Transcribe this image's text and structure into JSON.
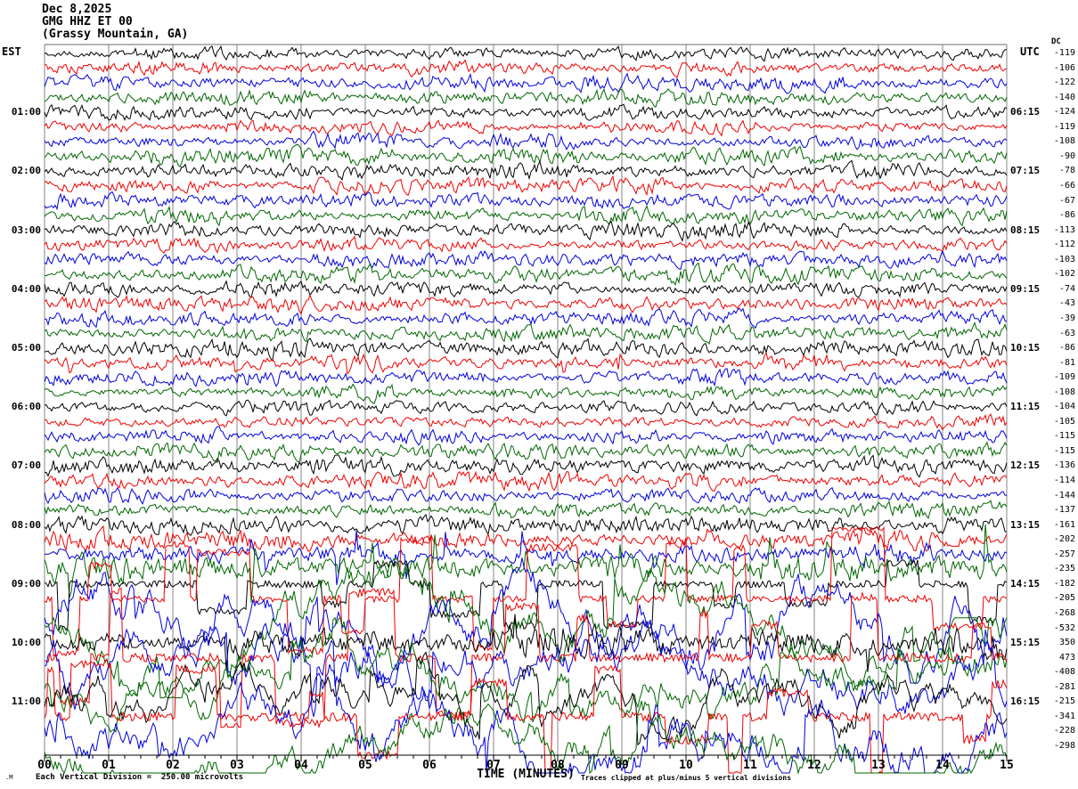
{
  "title": {
    "date": "Dec 8,2025",
    "station": "GMG HHZ ET 00",
    "location": "(Grassy Mountain, GA)"
  },
  "axes": {
    "left_header": "EST",
    "right_header": "UTC",
    "dc_header": "DC",
    "x_label": "TIME (MINUTES)",
    "x_ticks": [
      "00",
      "01",
      "02",
      "03",
      "04",
      "05",
      "06",
      "07",
      "08",
      "09",
      "10",
      "11",
      "12",
      "13",
      "14",
      "15"
    ],
    "minor_ticks_per_minute": 3,
    "footer_left": "Each Vertical Division =  250.00 microvolts",
    "footer_right": "Traces clipped at plus/minus 5 vertical divisions",
    "corner_mark": ".M"
  },
  "colors": {
    "black": "#000000",
    "red": "#ee0000",
    "blue": "#0000dd",
    "green": "#006600",
    "grid": "#858585",
    "border": "#6a6a6a",
    "axis": "#000000"
  },
  "chart_data": {
    "type": "line",
    "subtype": "seismogram-helicorder",
    "minutes_per_row": 15,
    "x_range_minutes": [
      0,
      15
    ],
    "vertical_division_microvolts": 250.0,
    "clip_divisions": 5,
    "rows": [
      {
        "est": "",
        "utc": "",
        "dc": "-119",
        "color": "black",
        "mode": "micro",
        "amp": 4
      },
      {
        "est": "",
        "utc": "",
        "dc": "-106",
        "color": "red",
        "mode": "micro",
        "amp": 4
      },
      {
        "est": "",
        "utc": "",
        "dc": "-122",
        "color": "blue",
        "mode": "micro",
        "amp": 4.5
      },
      {
        "est": "",
        "utc": "",
        "dc": "-140",
        "color": "green",
        "mode": "micro",
        "amp": 4.5
      },
      {
        "est": "01:00",
        "utc": "06:15",
        "dc": "-124",
        "color": "black",
        "mode": "micro",
        "amp": 4
      },
      {
        "est": "",
        "utc": "",
        "dc": "-119",
        "color": "red",
        "mode": "micro",
        "amp": 4
      },
      {
        "est": "",
        "utc": "",
        "dc": "-108",
        "color": "blue",
        "mode": "micro",
        "amp": 4.5
      },
      {
        "est": "",
        "utc": "",
        "dc": "-90",
        "color": "green",
        "mode": "micro",
        "amp": 5
      },
      {
        "est": "02:00",
        "utc": "07:15",
        "dc": "-78",
        "color": "black",
        "mode": "micro",
        "amp": 5
      },
      {
        "est": "",
        "utc": "",
        "dc": "-66",
        "color": "red",
        "mode": "micro",
        "amp": 4.5
      },
      {
        "est": "",
        "utc": "",
        "dc": "-67",
        "color": "blue",
        "mode": "micro",
        "amp": 4.5
      },
      {
        "est": "",
        "utc": "",
        "dc": "-86",
        "color": "green",
        "mode": "micro",
        "amp": 4.5
      },
      {
        "est": "03:00",
        "utc": "08:15",
        "dc": "-113",
        "color": "black",
        "mode": "micro",
        "amp": 5
      },
      {
        "est": "",
        "utc": "",
        "dc": "-112",
        "color": "red",
        "mode": "micro",
        "amp": 4.5
      },
      {
        "est": "",
        "utc": "",
        "dc": "-103",
        "color": "blue",
        "mode": "micro",
        "amp": 4.5
      },
      {
        "est": "",
        "utc": "",
        "dc": "-102",
        "color": "green",
        "mode": "micro",
        "amp": 5
      },
      {
        "est": "04:00",
        "utc": "09:15",
        "dc": "-74",
        "color": "black",
        "mode": "micro",
        "amp": 4.5
      },
      {
        "est": "",
        "utc": "",
        "dc": "-43",
        "color": "red",
        "mode": "micro",
        "amp": 4.5
      },
      {
        "est": "",
        "utc": "",
        "dc": "-39",
        "color": "blue",
        "mode": "micro",
        "amp": 4.5
      },
      {
        "est": "",
        "utc": "",
        "dc": "-63",
        "color": "green",
        "mode": "micro",
        "amp": 5
      },
      {
        "est": "05:00",
        "utc": "10:15",
        "dc": "-86",
        "color": "black",
        "mode": "micro",
        "amp": 5
      },
      {
        "est": "",
        "utc": "",
        "dc": "-81",
        "color": "red",
        "mode": "micro",
        "amp": 5.5,
        "spike": 10
      },
      {
        "est": "",
        "utc": "",
        "dc": "-109",
        "color": "blue",
        "mode": "micro",
        "amp": 4.5
      },
      {
        "est": "",
        "utc": "",
        "dc": "-108",
        "color": "green",
        "mode": "micro",
        "amp": 4.5
      },
      {
        "est": "06:00",
        "utc": "11:15",
        "dc": "-104",
        "color": "black",
        "mode": "micro",
        "amp": 4.5
      },
      {
        "est": "",
        "utc": "",
        "dc": "-105",
        "color": "red",
        "mode": "micro",
        "amp": 4.5
      },
      {
        "est": "",
        "utc": "",
        "dc": "-115",
        "color": "blue",
        "mode": "micro",
        "amp": 4.5
      },
      {
        "est": "",
        "utc": "",
        "dc": "-115",
        "color": "green",
        "mode": "micro",
        "amp": 4.5
      },
      {
        "est": "07:00",
        "utc": "12:15",
        "dc": "-136",
        "color": "black",
        "mode": "micro",
        "amp": 5
      },
      {
        "est": "",
        "utc": "",
        "dc": "-114",
        "color": "red",
        "mode": "micro",
        "amp": 5
      },
      {
        "est": "",
        "utc": "",
        "dc": "-144",
        "color": "blue",
        "mode": "micro",
        "amp": 4.5
      },
      {
        "est": "",
        "utc": "",
        "dc": "-137",
        "color": "green",
        "mode": "micro",
        "amp": 4.5
      },
      {
        "est": "08:00",
        "utc": "13:15",
        "dc": "-161",
        "color": "black",
        "mode": "micro",
        "amp": 5
      },
      {
        "est": "",
        "utc": "",
        "dc": "-202",
        "color": "red",
        "mode": "micro",
        "amp": 5.5,
        "spike": 12
      },
      {
        "est": "",
        "utc": "",
        "dc": "-257",
        "color": "blue",
        "mode": "micro",
        "amp": 6.5,
        "spike": 28,
        "clip": 60
      },
      {
        "est": "",
        "utc": "",
        "dc": "-235",
        "color": "green",
        "mode": "micro",
        "amp": 8,
        "spike": 45,
        "clip": 70
      },
      {
        "est": "09:00",
        "utc": "14:15",
        "dc": "-182",
        "color": "black",
        "mode": "telegraph",
        "amp": 4,
        "clip": 55,
        "p": 0.05,
        "bias": 0.75
      },
      {
        "est": "",
        "utc": "",
        "dc": "-205",
        "color": "red",
        "mode": "telegraph",
        "amp": 4,
        "clip": 80,
        "p": 0.11,
        "bias": 0.5
      },
      {
        "est": "",
        "utc": "",
        "dc": "-268",
        "color": "blue",
        "mode": "wander",
        "amp": 45,
        "clip": 78
      },
      {
        "est": "",
        "utc": "",
        "dc": "-532",
        "color": "green",
        "mode": "wander",
        "amp": 42,
        "clip": 78
      },
      {
        "est": "10:00",
        "utc": "15:15",
        "dc": "350",
        "color": "black",
        "mode": "micro",
        "amp": 9,
        "spike": 30,
        "clip": 70
      },
      {
        "est": "",
        "utc": "",
        "dc": "473",
        "color": "red",
        "mode": "telegraph",
        "amp": 5,
        "clip": 78,
        "p": 0.07,
        "bias": 0.45
      },
      {
        "est": "",
        "utc": "",
        "dc": "-408",
        "color": "blue",
        "mode": "wander",
        "amp": 45,
        "clip": 78
      },
      {
        "est": "",
        "utc": "",
        "dc": "-281",
        "color": "green",
        "mode": "wander",
        "amp": 40,
        "clip": 78
      },
      {
        "est": "11:00",
        "utc": "16:15",
        "dc": "-215",
        "color": "black",
        "mode": "wander",
        "amp": 36,
        "clip": 70
      },
      {
        "est": "",
        "utc": "",
        "dc": "-341",
        "color": "red",
        "mode": "telegraph",
        "amp": 5,
        "clip": 72,
        "p": 0.08,
        "bias": 0.5
      },
      {
        "est": "",
        "utc": "",
        "dc": "-228",
        "color": "blue",
        "mode": "wander",
        "amp": 45,
        "clip": 78
      },
      {
        "est": "",
        "utc": "",
        "dc": "-298",
        "color": "green",
        "mode": "wander",
        "amp": 40,
        "clip": 78
      }
    ]
  }
}
